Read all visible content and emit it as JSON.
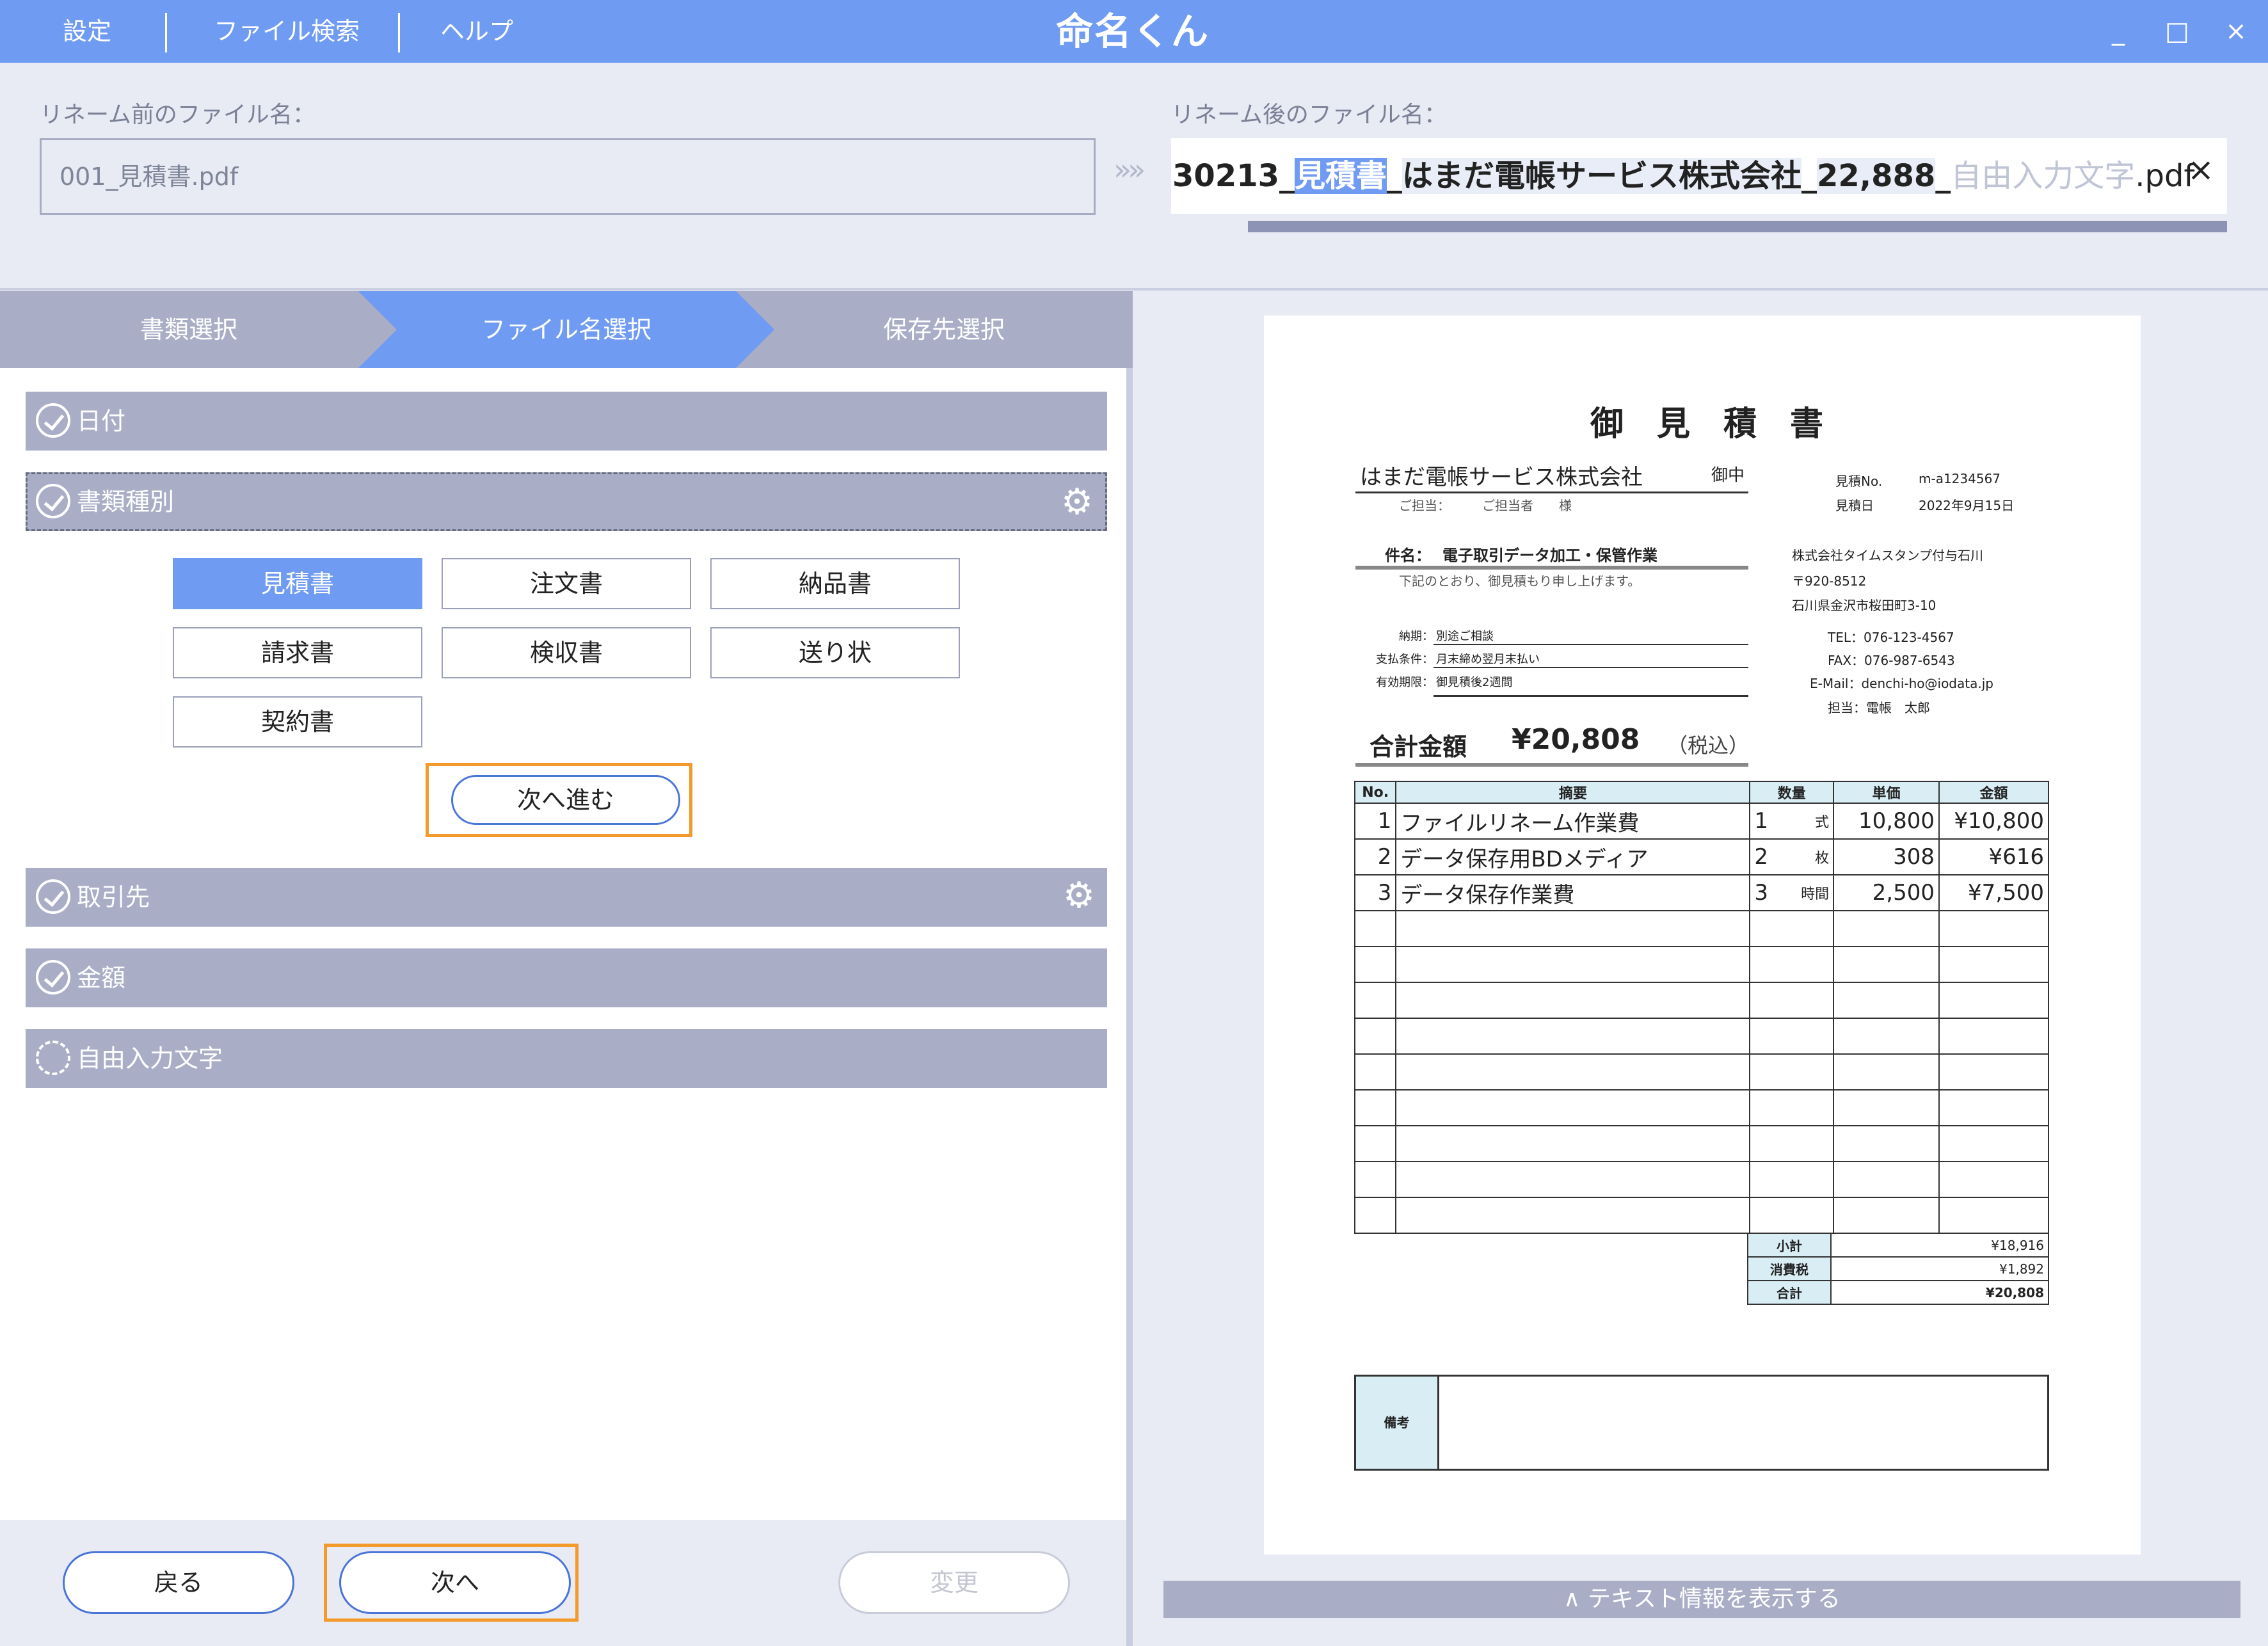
{
  "menu": {
    "settings": "設定",
    "file_search": "ファイル検索",
    "help": "ヘルプ"
  },
  "app": {
    "title": "命名くん"
  },
  "window": {
    "minimize": "_",
    "maximize": "□",
    "close": "×"
  },
  "rename": {
    "before_label": "リネーム前のファイル名：",
    "before_value": "001_見積書.pdf",
    "arrows": "»»",
    "after_label": "リネーム後のファイル名：",
    "after_parts": {
      "date": "30213",
      "sep1": "_",
      "doc_type": "見積書",
      "sep2": "_",
      "partner": "はまだ電帳サービス株式会社",
      "sep3": "_",
      "amount": "22,888",
      "sep4": "_",
      "free_text": "自由入力文字",
      "ext": ".pdf"
    },
    "clear": "×"
  },
  "steps": [
    "書類選択",
    "ファイル名選択",
    "保存先選択"
  ],
  "sections": {
    "date": "日付",
    "doc_type": "書類種別",
    "partner": "取引先",
    "amount": "金額",
    "free_text": "自由入力文字"
  },
  "doc_types": [
    "見積書",
    "注文書",
    "納品書",
    "請求書",
    "検収書",
    "送り状",
    "契約書"
  ],
  "doc_type_selected": "見積書",
  "next_step_button": "次へ進む",
  "footer": {
    "back": "戻る",
    "next": "次へ",
    "change": "変更"
  },
  "text_info_toggle": "∧ テキスト情報を表示する",
  "colors": {
    "accent": "#6f9bf2",
    "section": "#a9aec6",
    "highlight_frame": "#f39a2a"
  },
  "document": {
    "title": "御　見　積　書",
    "customer": "はまだ電帳サービス株式会社",
    "honorific": "御中",
    "contact_line": "ご担当：　　　ご担当者　　様",
    "estimate_no_label": "見積No.",
    "estimate_no": "m-a1234567",
    "estimate_date_label": "見積日",
    "estimate_date": "2022年9月15日",
    "subject_label": "件名：",
    "subject": "電子取引データ加工・保管作業",
    "intro": "下記のとおり、御見積もり申し上げます。",
    "issuer": "株式会社タイムスタンプ付与石川",
    "postal": "〒920-8512",
    "address": "石川県金沢市桜田町3-10",
    "tel": "TEL：076-123-4567",
    "fax": "FAX：076-987-6543",
    "email": "E-Mail：denchi-ho@iodata.jp",
    "person": "担当：電帳　太郎",
    "terms": [
      {
        "label": "納期：",
        "value": "別途ご相談"
      },
      {
        "label": "支払条件：",
        "value": "月末締め翌月末払い"
      },
      {
        "label": "有効期限：",
        "value": "御見積後2週間"
      }
    ],
    "total_label": "合計金額",
    "total_value": "¥20,808",
    "tax_note": "（税込）",
    "columns": [
      "No.",
      "摘要",
      "数量",
      "単価",
      "金額"
    ],
    "items": [
      {
        "no": "1",
        "desc": "ファイルリネーム作業費",
        "qty": "1",
        "unit": "式",
        "price": "10,800",
        "amount": "¥10,800"
      },
      {
        "no": "2",
        "desc": "データ保存用BDメディア",
        "qty": "2",
        "unit": "枚",
        "price": "308",
        "amount": "¥616"
      },
      {
        "no": "3",
        "desc": "データ保存作業費",
        "qty": "3",
        "unit": "時間",
        "price": "2,500",
        "amount": "¥7,500"
      }
    ],
    "subtotal_label": "小計",
    "subtotal": "¥18,916",
    "tax_label": "消費税",
    "tax": "¥1,892",
    "grand_label": "合計",
    "grand": "¥20,808",
    "remarks_label": "備考"
  }
}
